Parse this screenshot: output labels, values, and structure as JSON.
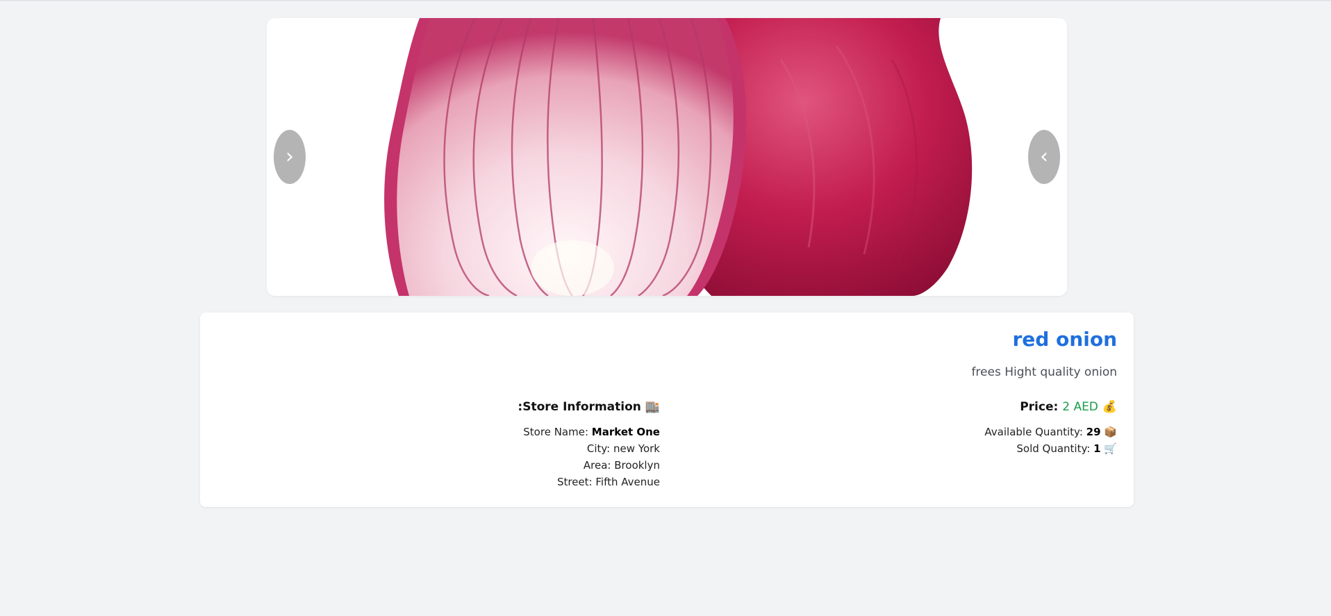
{
  "carousel": {
    "image_alt": "red onion",
    "prev_glyph": "›",
    "next_glyph": "‹"
  },
  "product": {
    "name": "red onion",
    "description": "frees Hight quality onion",
    "price_label": "Price:",
    "price_value": "2 AED",
    "price_icon": "💰",
    "available_label": "Available Quantity:",
    "available_value": "29",
    "available_icon": "📦",
    "sold_label": "Sold Quantity:",
    "sold_value": "1",
    "sold_icon": "🛒"
  },
  "store": {
    "heading": ":Store Information",
    "heading_icon": "🏬",
    "name_label": "Store Name:",
    "name_value": "Market One",
    "city_label": "City:",
    "city_value": "new York",
    "area_label": "Area:",
    "area_value": "Brooklyn",
    "street_label": "Street:",
    "street_value": "Fifth Avenue"
  },
  "colors": {
    "title": "#1f6fde",
    "price": "#1a9c4a",
    "background": "#f2f3f5"
  }
}
